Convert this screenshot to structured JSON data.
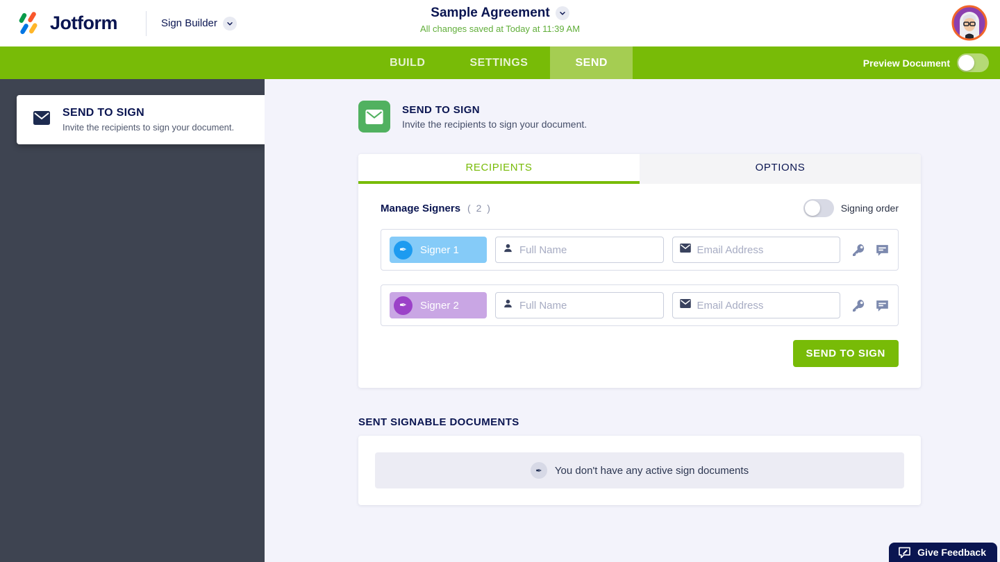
{
  "header": {
    "logo_text": "Jotform",
    "product_name": "Sign Builder",
    "document_title": "Sample Agreement",
    "save_status": "All changes saved at Today at 11:39 AM"
  },
  "navbar": {
    "tabs": [
      {
        "label": "BUILD",
        "active": false
      },
      {
        "label": "SETTINGS",
        "active": false
      },
      {
        "label": "SEND",
        "active": true
      }
    ],
    "preview_toggle_label": "Preview Document",
    "preview_toggle_on": false
  },
  "sidebar": {
    "items": [
      {
        "title": "SEND TO SIGN",
        "description": "Invite the recipients to sign your document.",
        "active": true
      }
    ]
  },
  "main": {
    "section": {
      "title": "SEND TO SIGN",
      "description": "Invite the recipients to sign your document."
    },
    "card": {
      "tabs": [
        {
          "label": "RECIPIENTS",
          "active": true
        },
        {
          "label": "OPTIONS",
          "active": false
        }
      ],
      "manage_signers_label": "Manage Signers",
      "signer_count": "( 2 )",
      "signing_order_label": "Signing order",
      "signing_order_on": false,
      "signers": [
        {
          "label": "Signer 1",
          "full_name_value": "",
          "full_name_placeholder": "Full Name",
          "email_value": "",
          "email_placeholder": "Email Address"
        },
        {
          "label": "Signer 2",
          "full_name_value": "",
          "full_name_placeholder": "Full Name",
          "email_value": "",
          "email_placeholder": "Email Address"
        }
      ],
      "send_button_label": "SEND TO SIGN"
    },
    "sent_documents": {
      "heading": "SENT SIGNABLE DOCUMENTS",
      "empty_message": "You don't have any active sign documents"
    }
  },
  "feedback_button_label": "Give Feedback",
  "colors": {
    "brand_green": "#78BB07",
    "send_tab_highlight": "#A5CD52",
    "navy": "#0A1551",
    "sidebar_bg": "#3E4451",
    "content_bg": "#F3F3FB",
    "saved_text_green": "#61AE3A",
    "signer1_chip": "#85CBF8",
    "signer1_circle": "#1D9BF0",
    "signer2_chip": "#C9A6E4",
    "signer2_circle": "#9B41C8",
    "arrow_orange": "#F0641E",
    "section_icon_green": "#51B160",
    "row_icon_slate": "#7C89AE",
    "feedback_bg": "#0A1551"
  }
}
